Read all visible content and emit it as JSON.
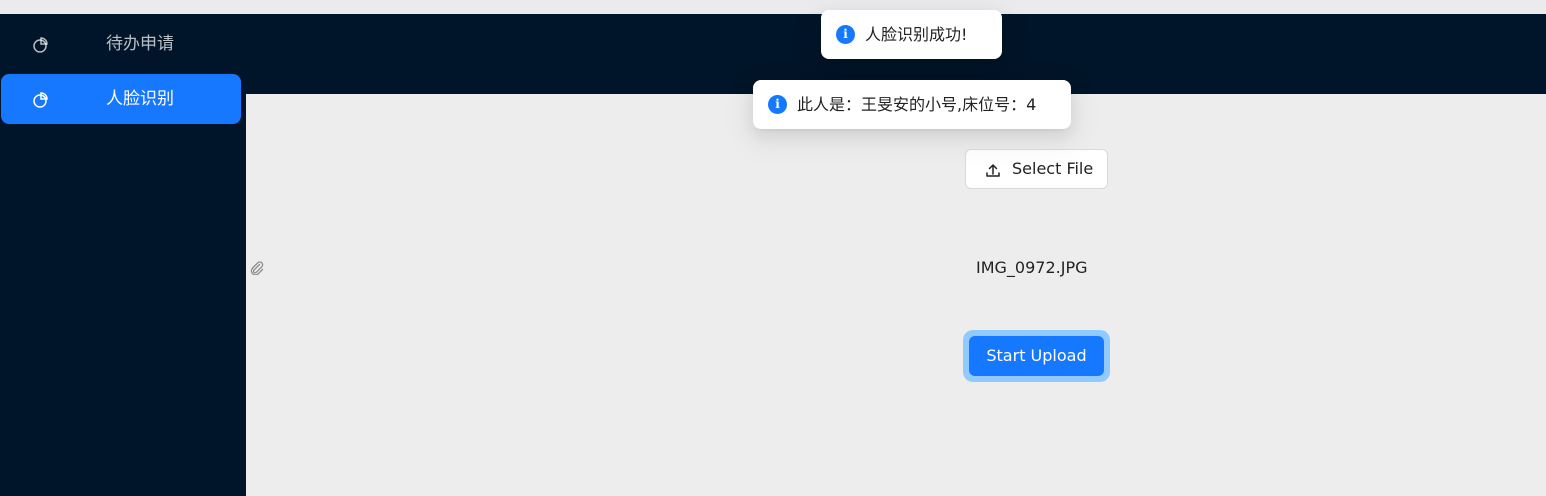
{
  "sidebar": {
    "items": [
      {
        "label": "待办申请",
        "icon": "pie-chart-icon",
        "active": false
      },
      {
        "label": "人脸识别",
        "icon": "pie-chart-icon",
        "active": true
      }
    ]
  },
  "upload": {
    "select_label": "Select File",
    "file_name": "IMG_0972.JPG",
    "start_label": "Start Upload"
  },
  "messages": [
    {
      "text": "人脸识别成功!",
      "icon": "info-icon"
    },
    {
      "text": "此人是：王旻安的小号,床位号：4",
      "icon": "info-icon"
    }
  ],
  "colors": {
    "sidebar_bg": "#001529",
    "accent": "#1677ff",
    "content_bg": "#ededed"
  }
}
